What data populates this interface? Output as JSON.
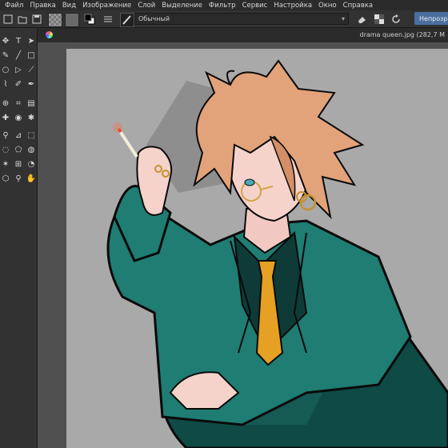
{
  "menu": [
    "Файл",
    "Правка",
    "Вид",
    "Изображение",
    "Слой",
    "Выделение",
    "Фильтр",
    "Сервис",
    "Настройка",
    "Окно",
    "Справка"
  ],
  "toolbar": {
    "blend_mode": "Обычный",
    "opacity_button": "Непрозр"
  },
  "document": {
    "tab_title": "drama queen.jpg (282,7 M"
  },
  "colors": {
    "menubar": "#2b2b2b",
    "toolbar": "#323232",
    "canvas_bg": "#505050",
    "jacket": "#1f7d73",
    "hair": "#e2a27a",
    "tie": "#e6a023",
    "accent": "#4a6f9e"
  },
  "icons": {
    "tools": [
      "move-icon",
      "text-icon",
      "pointer-icon",
      "brush-icon",
      "line-icon",
      "rect-icon",
      "ellipse-icon",
      "polygon-icon",
      "polyline-icon",
      "path-icon",
      "freehand-path-icon",
      "calligraphy-icon",
      "transform-icon",
      "crop-icon",
      "gradient-icon",
      "colorpicker-icon",
      "fill-icon",
      "smart-patch-icon",
      "assistant-icon",
      "measure-icon",
      "rect-select-icon",
      "ellipse-select-icon",
      "polygon-select-icon",
      "freehand-select-icon",
      "contiguous-select-icon",
      "similar-select-icon",
      "bezier-select-icon",
      "magnetic-select-icon",
      "zoom-icon",
      "pan-icon"
    ]
  }
}
